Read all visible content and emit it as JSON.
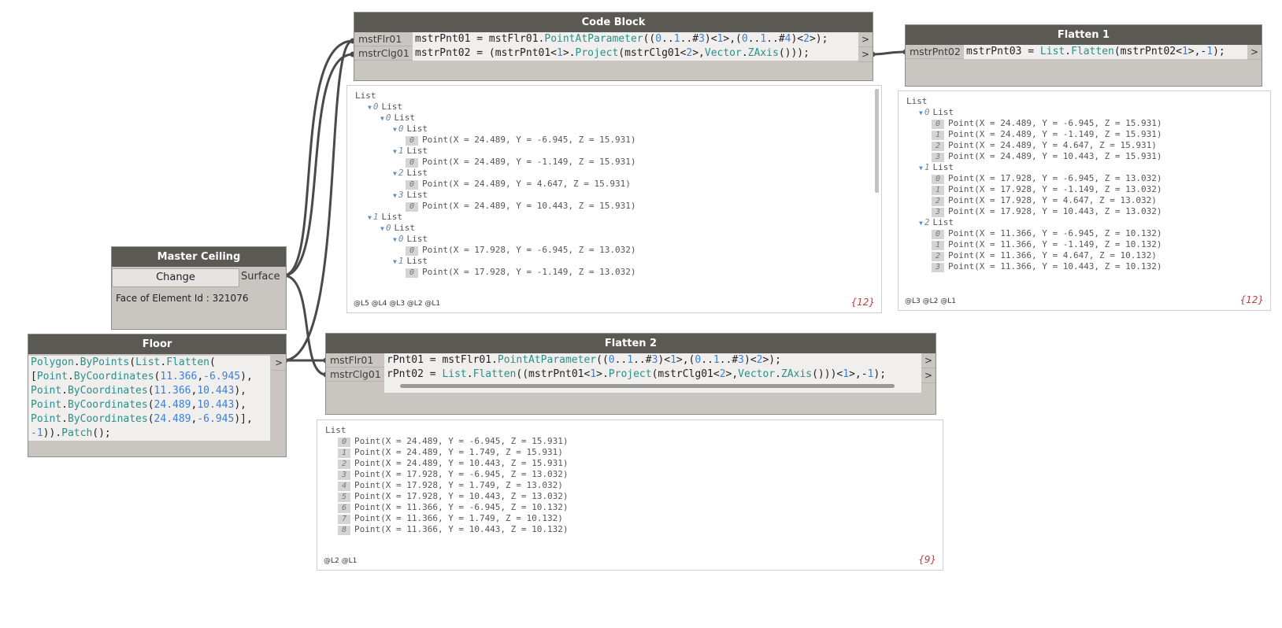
{
  "nodes": {
    "code_block": {
      "title": "Code Block",
      "ports": [
        "mstFlr01",
        "mstrClg01"
      ],
      "outputs": [
        ">",
        ">"
      ],
      "lines": [
        [
          [
            "mstrPnt01 = mstFlr01.",
            ""
          ],
          [
            "PointAtParameter",
            "kw"
          ],
          [
            "((",
            ""
          ],
          [
            "0",
            "num"
          ],
          [
            "..",
            ""
          ],
          [
            "1",
            "num"
          ],
          [
            "..#",
            ""
          ],
          [
            "3",
            "num"
          ],
          [
            ")<",
            ""
          ],
          [
            "1",
            "num"
          ],
          [
            ">,(",
            ""
          ],
          [
            "0",
            "num"
          ],
          [
            "..",
            ""
          ],
          [
            "1",
            "num"
          ],
          [
            "..#",
            ""
          ],
          [
            "4",
            "num"
          ],
          [
            ")<",
            ""
          ],
          [
            "2",
            "num"
          ],
          [
            ">);",
            ""
          ]
        ],
        [
          [
            "mstrPnt02 = (mstrPnt01<",
            ""
          ],
          [
            "1",
            "num"
          ],
          [
            ">.",
            ""
          ],
          [
            "Project",
            "kw"
          ],
          [
            "(mstrClg01<",
            ""
          ],
          [
            "2",
            "num"
          ],
          [
            ">,",
            ""
          ],
          [
            "Vector",
            "kw"
          ],
          [
            ".",
            ""
          ],
          [
            "ZAxis",
            "kw"
          ],
          [
            "()));",
            ""
          ]
        ]
      ]
    },
    "flatten1": {
      "title": "Flatten 1",
      "ports": [
        "mstrPnt02"
      ],
      "outputs": [
        ">"
      ],
      "lines": [
        [
          [
            "mstrPnt03 = ",
            ""
          ],
          [
            "List",
            "kw"
          ],
          [
            ".",
            ""
          ],
          [
            "Flatten",
            "kw"
          ],
          [
            "(mstrPnt02<",
            ""
          ],
          [
            "1",
            "num"
          ],
          [
            ">,-",
            ""
          ],
          [
            "1",
            "num"
          ],
          [
            ");",
            ""
          ]
        ]
      ]
    },
    "master_ceiling": {
      "title": "Master Ceiling",
      "button": "Change",
      "output": "Surface",
      "info": "Face of Element Id : 321076"
    },
    "floor": {
      "title": "Floor",
      "outputs": [
        ">"
      ],
      "lines": [
        [
          [
            "Polygon",
            "kw"
          ],
          [
            ".",
            ""
          ],
          [
            "ByPoints",
            "kw"
          ],
          [
            "(",
            ""
          ],
          [
            "List",
            "kw"
          ],
          [
            ".",
            ""
          ],
          [
            "Flatten",
            "kw"
          ],
          [
            "(",
            ""
          ]
        ],
        [
          [
            "[",
            ""
          ],
          [
            "Point",
            "kw"
          ],
          [
            ".",
            ""
          ],
          [
            "ByCoordinates",
            "kw"
          ],
          [
            "(",
            ""
          ],
          [
            "11.366",
            "num"
          ],
          [
            ",",
            ""
          ],
          [
            "-6.945",
            "num"
          ],
          [
            "),",
            ""
          ]
        ],
        [
          [
            "Point",
            "kw"
          ],
          [
            ".",
            ""
          ],
          [
            "ByCoordinates",
            "kw"
          ],
          [
            "(",
            ""
          ],
          [
            "11.366",
            "num"
          ],
          [
            ",",
            ""
          ],
          [
            "10.443",
            "num"
          ],
          [
            "),",
            ""
          ]
        ],
        [
          [
            "Point",
            "kw"
          ],
          [
            ".",
            ""
          ],
          [
            "ByCoordinates",
            "kw"
          ],
          [
            "(",
            ""
          ],
          [
            "24.489",
            "num"
          ],
          [
            ",",
            ""
          ],
          [
            "10.443",
            "num"
          ],
          [
            "),",
            ""
          ]
        ],
        [
          [
            "Point",
            "kw"
          ],
          [
            ".",
            ""
          ],
          [
            "ByCoordinates",
            "kw"
          ],
          [
            "(",
            ""
          ],
          [
            "24.489",
            "num"
          ],
          [
            ",",
            ""
          ],
          [
            "-6.945",
            "num"
          ],
          [
            ")],",
            ""
          ]
        ],
        [
          [
            "-",
            "num"
          ],
          [
            "1",
            "num"
          ],
          [
            ")).",
            ""
          ],
          [
            "Patch",
            "kw"
          ],
          [
            "();",
            ""
          ]
        ]
      ]
    },
    "flatten2": {
      "title": "Flatten 2",
      "ports": [
        "mstFlr01",
        "mstrClg01"
      ],
      "outputs": [
        ">",
        ">"
      ],
      "lines": [
        [
          [
            "rPnt01 = mstFlr01.",
            ""
          ],
          [
            "PointAtParameter",
            "kw"
          ],
          [
            "((",
            ""
          ],
          [
            "0",
            "num"
          ],
          [
            "..",
            ""
          ],
          [
            "1",
            "num"
          ],
          [
            "..#",
            ""
          ],
          [
            "3",
            "num"
          ],
          [
            ")<",
            ""
          ],
          [
            "1",
            "num"
          ],
          [
            ">,(",
            ""
          ],
          [
            "0",
            "num"
          ],
          [
            "..",
            ""
          ],
          [
            "1",
            "num"
          ],
          [
            "..#",
            ""
          ],
          [
            "3",
            "num"
          ],
          [
            ")<",
            ""
          ],
          [
            "2",
            "num"
          ],
          [
            ">);",
            ""
          ]
        ],
        [
          [
            "rPnt02 = ",
            ""
          ],
          [
            "List",
            "kw"
          ],
          [
            ".",
            ""
          ],
          [
            "Flatten",
            "kw"
          ],
          [
            "((mstrPnt01<",
            ""
          ],
          [
            "1",
            "num"
          ],
          [
            ">.",
            ""
          ],
          [
            "Project",
            "kw"
          ],
          [
            "(mstrClg01<",
            ""
          ],
          [
            "2",
            "num"
          ],
          [
            ">,",
            ""
          ],
          [
            "Vector",
            "kw"
          ],
          [
            ".",
            ""
          ],
          [
            "ZAxis",
            "kw"
          ],
          [
            "()))<",
            ""
          ],
          [
            "1",
            "num"
          ],
          [
            ">,-",
            ""
          ],
          [
            "1",
            "num"
          ],
          [
            ");",
            ""
          ]
        ]
      ]
    }
  },
  "previews": {
    "code_block": {
      "footer": "@L5 @L4 @L3 @L2 @L1",
      "count": "{12}",
      "rows": [
        {
          "d": 0,
          "t": "List"
        },
        {
          "d": 1,
          "i": "0",
          "t": "List",
          "tri": true
        },
        {
          "d": 2,
          "i": "0",
          "t": "List",
          "tri": true
        },
        {
          "d": 3,
          "i": "0",
          "t": "List",
          "tri": true
        },
        {
          "d": 4,
          "i": "0",
          "t": "Point(X = 24.489, Y = -6.945, Z = 15.931)",
          "leaf": true
        },
        {
          "d": 3,
          "i": "1",
          "t": "List",
          "tri": true
        },
        {
          "d": 4,
          "i": "0",
          "t": "Point(X = 24.489, Y = -1.149, Z = 15.931)",
          "leaf": true
        },
        {
          "d": 3,
          "i": "2",
          "t": "List",
          "tri": true
        },
        {
          "d": 4,
          "i": "0",
          "t": "Point(X = 24.489, Y = 4.647, Z = 15.931)",
          "leaf": true
        },
        {
          "d": 3,
          "i": "3",
          "t": "List",
          "tri": true
        },
        {
          "d": 4,
          "i": "0",
          "t": "Point(X = 24.489, Y = 10.443, Z = 15.931)",
          "leaf": true
        },
        {
          "d": 1,
          "i": "1",
          "t": "List",
          "tri": true
        },
        {
          "d": 2,
          "i": "0",
          "t": "List",
          "tri": true
        },
        {
          "d": 3,
          "i": "0",
          "t": "List",
          "tri": true
        },
        {
          "d": 4,
          "i": "0",
          "t": "Point(X = 17.928, Y = -6.945, Z = 13.032)",
          "leaf": true
        },
        {
          "d": 3,
          "i": "1",
          "t": "List",
          "tri": true
        },
        {
          "d": 4,
          "i": "0",
          "t": "Point(X = 17.928, Y = -1.149, Z = 13.032)",
          "leaf": true
        }
      ]
    },
    "flatten1": {
      "footer": "@L3 @L2 @L1",
      "count": "{12}",
      "rows": [
        {
          "d": 0,
          "t": "List"
        },
        {
          "d": 1,
          "i": "0",
          "t": "List",
          "tri": true
        },
        {
          "d": 2,
          "i": "0",
          "t": "Point(X = 24.489, Y = -6.945, Z = 15.931)",
          "leaf": true
        },
        {
          "d": 2,
          "i": "1",
          "t": "Point(X = 24.489, Y = -1.149, Z = 15.931)",
          "leaf": true
        },
        {
          "d": 2,
          "i": "2",
          "t": "Point(X = 24.489, Y = 4.647, Z = 15.931)",
          "leaf": true
        },
        {
          "d": 2,
          "i": "3",
          "t": "Point(X = 24.489, Y = 10.443, Z = 15.931)",
          "leaf": true
        },
        {
          "d": 1,
          "i": "1",
          "t": "List",
          "tri": true
        },
        {
          "d": 2,
          "i": "0",
          "t": "Point(X = 17.928, Y = -6.945, Z = 13.032)",
          "leaf": true
        },
        {
          "d": 2,
          "i": "1",
          "t": "Point(X = 17.928, Y = -1.149, Z = 13.032)",
          "leaf": true
        },
        {
          "d": 2,
          "i": "2",
          "t": "Point(X = 17.928, Y = 4.647, Z = 13.032)",
          "leaf": true
        },
        {
          "d": 2,
          "i": "3",
          "t": "Point(X = 17.928, Y = 10.443, Z = 13.032)",
          "leaf": true
        },
        {
          "d": 1,
          "i": "2",
          "t": "List",
          "tri": true
        },
        {
          "d": 2,
          "i": "0",
          "t": "Point(X = 11.366, Y = -6.945, Z = 10.132)",
          "leaf": true
        },
        {
          "d": 2,
          "i": "1",
          "t": "Point(X = 11.366, Y = -1.149, Z = 10.132)",
          "leaf": true
        },
        {
          "d": 2,
          "i": "2",
          "t": "Point(X = 11.366, Y = 4.647, Z = 10.132)",
          "leaf": true
        },
        {
          "d": 2,
          "i": "3",
          "t": "Point(X = 11.366, Y = 10.443, Z = 10.132)",
          "leaf": true
        }
      ]
    },
    "flatten2": {
      "footer": "@L2 @L1",
      "count": "{9}",
      "rows": [
        {
          "d": 0,
          "t": "List"
        },
        {
          "d": 1,
          "i": "0",
          "t": "Point(X = 24.489, Y = -6.945, Z = 15.931)",
          "leaf": true
        },
        {
          "d": 1,
          "i": "1",
          "t": "Point(X = 24.489, Y = 1.749, Z = 15.931)",
          "leaf": true
        },
        {
          "d": 1,
          "i": "2",
          "t": "Point(X = 24.489, Y = 10.443, Z = 15.931)",
          "leaf": true
        },
        {
          "d": 1,
          "i": "3",
          "t": "Point(X = 17.928, Y = -6.945, Z = 13.032)",
          "leaf": true
        },
        {
          "d": 1,
          "i": "4",
          "t": "Point(X = 17.928, Y = 1.749, Z = 13.032)",
          "leaf": true
        },
        {
          "d": 1,
          "i": "5",
          "t": "Point(X = 17.928, Y = 10.443, Z = 13.032)",
          "leaf": true
        },
        {
          "d": 1,
          "i": "6",
          "t": "Point(X = 11.366, Y = -6.945, Z = 10.132)",
          "leaf": true
        },
        {
          "d": 1,
          "i": "7",
          "t": "Point(X = 11.366, Y = 1.749, Z = 10.132)",
          "leaf": true
        },
        {
          "d": 1,
          "i": "8",
          "t": "Point(X = 11.366, Y = 10.443, Z = 10.132)",
          "leaf": true
        }
      ]
    }
  },
  "colors": {
    "node_title_bg": "#5b5954",
    "node_body": "#c9c6c1",
    "keyword": "#2a8f8a",
    "number": "#3d7fd1",
    "count_text": "#c23a3a",
    "wire": "#4a4a4a"
  }
}
